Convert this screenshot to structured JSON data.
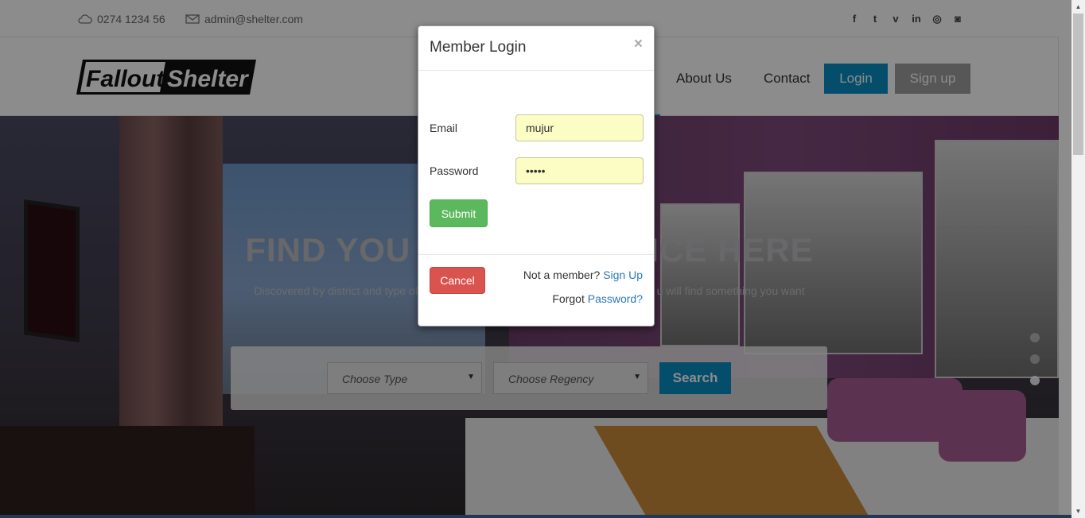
{
  "topbar": {
    "phone": "0274 1234 56",
    "email": "admin@shelter.com",
    "phone_icon": "cloud-icon",
    "email_icon": "envelope-icon",
    "social": [
      {
        "name": "facebook-icon",
        "glyph": "f"
      },
      {
        "name": "twitter-icon",
        "glyph": "t"
      },
      {
        "name": "vine-icon",
        "glyph": "v"
      },
      {
        "name": "linkedin-icon",
        "glyph": "in"
      },
      {
        "name": "dribbble-icon",
        "glyph": "◎"
      },
      {
        "name": "instagram-icon",
        "glyph": "◙"
      }
    ]
  },
  "navbar": {
    "logo_text": "Fallout Shelter",
    "links": [
      "About Us",
      "Contact"
    ],
    "login_label": "Login",
    "signup_label": "Sign up",
    "accent_color": "#0a8fc4"
  },
  "hero": {
    "title_left": "FIND YOU",
    "title_right": "ICE HERE",
    "subtitle_left": "Discovered by district and type of",
    "subtitle_right": "u will find something you want",
    "search": {
      "type_placeholder": "Choose Type",
      "regency_placeholder": "Choose Regency",
      "button_label": "Search"
    },
    "slide_count": 3,
    "active_slide": 3
  },
  "modal": {
    "title": "Member Login",
    "close_label": "×",
    "email_label": "Email",
    "email_value": "mujur",
    "password_label": "Password",
    "password_value": "•••••",
    "submit_label": "Submit",
    "cancel_label": "Cancel",
    "not_member_text": "Not a member?",
    "signup_link": "Sign Up",
    "forgot_text": "Forgot",
    "password_link": "Password?"
  }
}
